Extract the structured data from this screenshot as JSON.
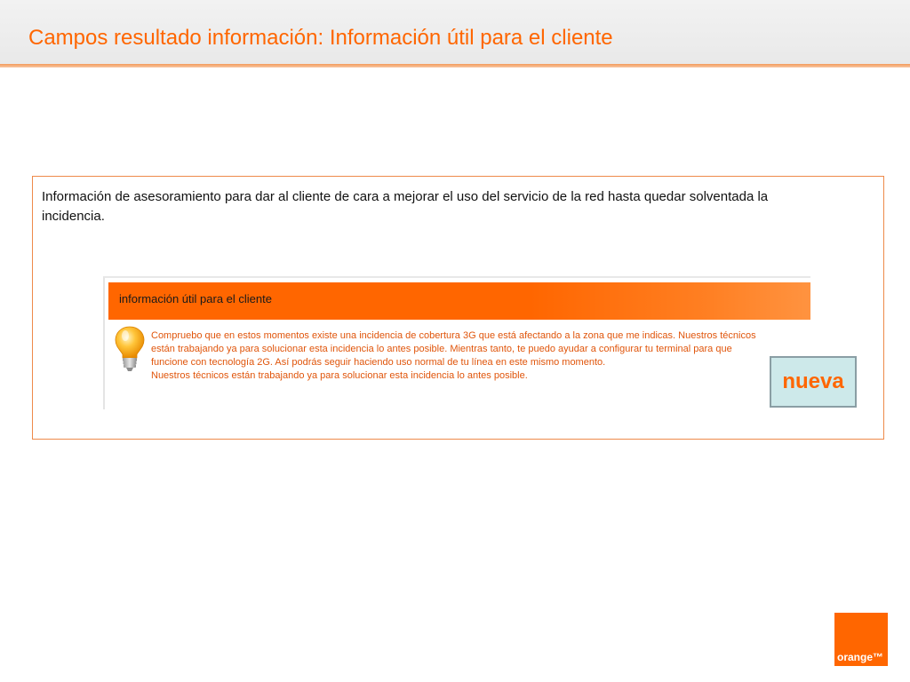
{
  "header": {
    "title": "Campos resultado información:  Información útil para el cliente"
  },
  "content": {
    "description": "Información de asesoramiento para dar al cliente de cara a mejorar el uso del servicio de la red hasta quedar solventada la incidencia.",
    "panel": {
      "header_label": "información útil para el cliente",
      "icon": "lightbulb-icon",
      "lines": [
        "Compruebo que en estos momentos existe una incidencia de cobertura 3G que está afectando a la zona que me indicas. Nuestros técnicos",
        "están trabajando ya para solucionar esta incidencia lo antes posible. Mientras tanto, te puedo ayudar a configurar tu terminal para que",
        "funcione con tecnología 2G. Así podrás seguir haciendo uso normal de tu línea en este mismo momento.",
        "Nuestros técnicos están trabajando ya para solucionar esta incidencia lo antes posible."
      ]
    },
    "badge": "nueva"
  },
  "logo": {
    "text": "orange™"
  },
  "colors": {
    "accent": "#ff6600",
    "box_border": "#ee8a4a",
    "badge_bg": "#cde9ea",
    "panel_text": "#e0550b"
  }
}
